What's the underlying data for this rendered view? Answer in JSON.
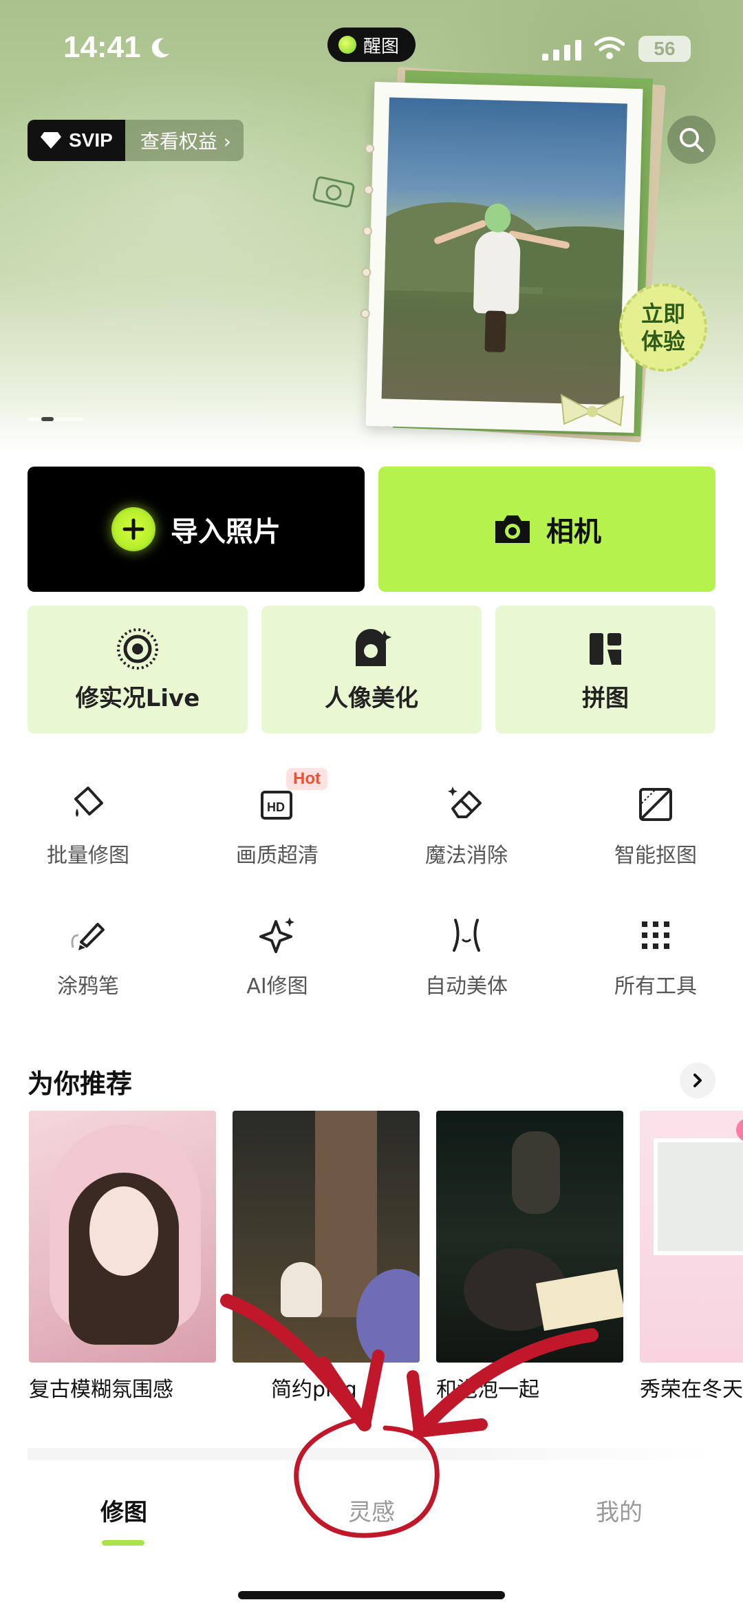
{
  "status_bar": {
    "time": "14:41",
    "island_label": "醒图",
    "battery": "56"
  },
  "banner": {
    "svip_label": "SVIP",
    "benefits_label": "查看权益 ›",
    "try_line1": "立即",
    "try_line2": "体验"
  },
  "actions": {
    "import_label": "导入照片",
    "camera_label": "相机"
  },
  "features": [
    {
      "label": "修实况Live",
      "icon": "live-photo-icon"
    },
    {
      "label": "人像美化",
      "icon": "portrait-icon"
    },
    {
      "label": "拼图",
      "icon": "collage-icon"
    }
  ],
  "tools": [
    {
      "label": "批量修图",
      "icon": "batch-edit-icon"
    },
    {
      "label": "画质超清",
      "icon": "hd-icon",
      "badge": "Hot"
    },
    {
      "label": "魔法消除",
      "icon": "eraser-icon"
    },
    {
      "label": "智能抠图",
      "icon": "cutout-icon"
    },
    {
      "label": "涂鸦笔",
      "icon": "brush-icon"
    },
    {
      "label": "AI修图",
      "icon": "ai-sparkle-icon"
    },
    {
      "label": "自动美体",
      "icon": "body-shape-icon"
    },
    {
      "label": "所有工具",
      "icon": "grid-dots-icon"
    }
  ],
  "recommend": {
    "title": "为你推荐",
    "items": [
      {
        "caption": "复古模糊氛围感"
      },
      {
        "caption": "简约plog"
      },
      {
        "caption": "和泡泡一起"
      },
      {
        "caption": "秀荣在冬天"
      }
    ]
  },
  "bottom_nav": {
    "tabs": [
      "修图",
      "灵感",
      "我的"
    ],
    "active_index": 0
  },
  "colors": {
    "accent_green": "#b5f24e",
    "feature_bg": "#e9f8d3",
    "annotation_red": "#c0182a"
  }
}
